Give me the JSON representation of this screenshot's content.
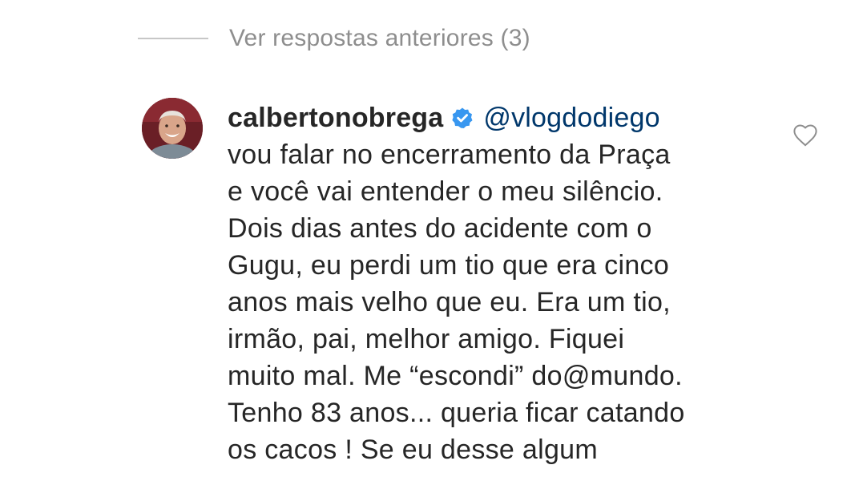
{
  "replies": {
    "toggle_label": "Ver respostas anteriores (3)"
  },
  "comment": {
    "username": "calbertonobrega",
    "verified_icon": "verified-badge-icon",
    "mention": "@vlogdodiego",
    "lines": [
      "vou falar no encerramento da Praça",
      "e você vai entender o meu silêncio.",
      "Dois dias antes do acidente com o",
      "Gugu, eu perdi um tio que era cinco",
      "anos mais velho que eu. Era um tio,",
      "irmão, pai, melhor amigo. Fiquei",
      "muito mal. Me “escondi” do@mundo.",
      "Tenho 83 anos... queria ficar catando",
      "os cacos ! Se eu desse algum"
    ],
    "like_icon": "heart-outline-icon"
  },
  "colors": {
    "text": "#262626",
    "muted": "#8e8e8e",
    "mention": "#00376b",
    "verified": "#3897f0",
    "divider": "#c7c7c7"
  }
}
